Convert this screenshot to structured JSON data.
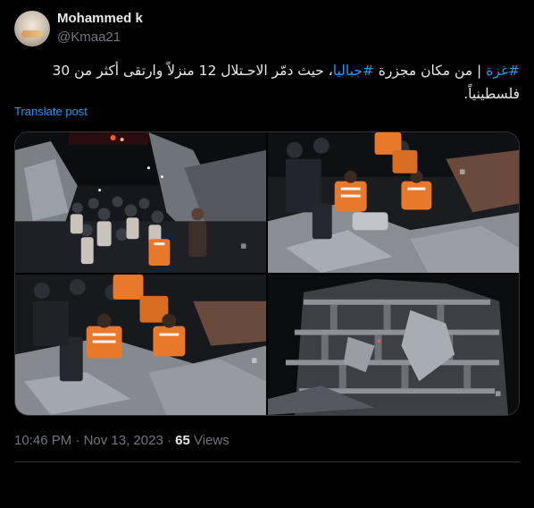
{
  "post": {
    "author": {
      "name": "Mohammed k",
      "handle": "@Kmaa21"
    },
    "text": {
      "hashtag1": "#غزة",
      "segment1": " | من مكان مجزرة ",
      "hashtag2": "#جباليا",
      "segment2": "، حيث دمّر الاحـتلال 12 منزلاً وارتقى أكثر من 30 فلسطينياً."
    },
    "translate_label": "Translate post",
    "media": [
      {
        "description": "crowd-rescue-night",
        "watermark": ""
      },
      {
        "description": "rescuers-digging-rubble",
        "watermark": ""
      },
      {
        "description": "rescuers-in-debris",
        "watermark": ""
      },
      {
        "description": "destroyed-building-night",
        "watermark": ""
      }
    ],
    "meta": {
      "time": "10:46 PM",
      "separator": " · ",
      "date": "Nov 13, 2023",
      "views_sep": " · ",
      "views_count": "65",
      "views_label": " Views"
    }
  },
  "colors": {
    "background": "#000000",
    "text_primary": "#e7e9ea",
    "text_secondary": "#71767b",
    "accent": "#1d9bf0",
    "border": "#2f3336",
    "vest_orange": "#e8782a"
  }
}
